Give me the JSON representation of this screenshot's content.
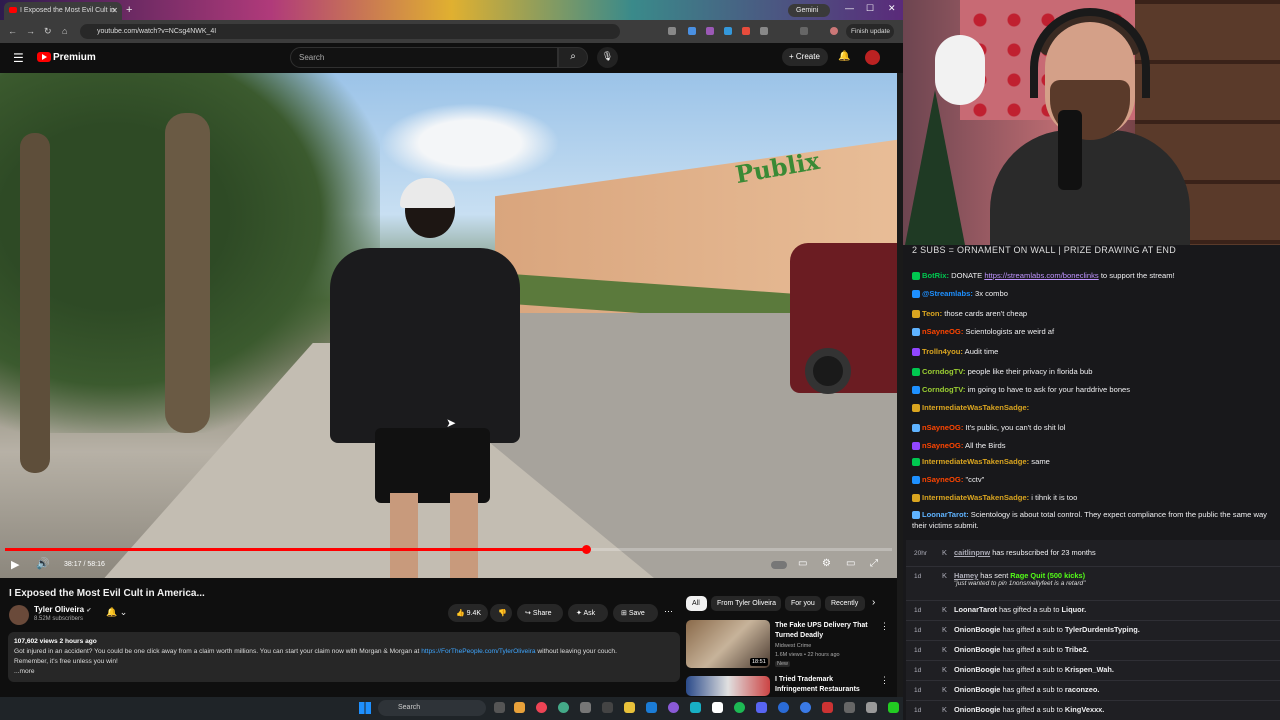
{
  "browser": {
    "tab_title": "I Exposed the Most Evil Cult in",
    "new_tab": "+",
    "gemini": "Gemini",
    "url": "youtube.com/watch?v=NCsg4NWK_4I",
    "finish_update": "Finish update",
    "win_min": "—",
    "win_max": "☐",
    "win_close": "✕"
  },
  "youtube": {
    "menu_icon": "☰",
    "brand": "Premium",
    "search_placeholder": "Search",
    "search_icon": "⌕",
    "mic_icon": "🎙",
    "create_label": "+ Create",
    "bell_icon": "🔔"
  },
  "player": {
    "progress_fraction": 0.655,
    "time": "38:17 / 58:16",
    "play_icon": "▶",
    "volume_icon": "🔊"
  },
  "video": {
    "title": "I Exposed the Most Evil Cult in America...",
    "channel": "Tyler Oliveira",
    "verified": "✔",
    "subscribers": "8.52M subscribers",
    "likes": "9.4K",
    "share": "Share",
    "ask": "Ask",
    "save": "Save",
    "views_time": "107,602 views  2 hours ago",
    "desc_line1_a": "Got injured in an accident? You could be one click away from a claim worth millions. You can start your claim now with Morgan & Morgan at ",
    "desc_link": "https://ForThePeople.com/TylerOliveira",
    "desc_line1_b": " without leaving your couch.",
    "desc_line2": "Remember, it's free unless you win!",
    "more": "...more"
  },
  "recs": {
    "chips": [
      "All",
      "From Tyler Oliveira",
      "For you",
      "Recently"
    ],
    "items": [
      {
        "title": "The Fake UPS Delivery That Turned Deadly",
        "channel": "Midwest Crime",
        "meta": "1.6M views • 22 hours ago",
        "badge": "New",
        "duration": "18:51"
      },
      {
        "title": "I Tried Trademark Infringement Restaurants",
        "channel": "",
        "meta": "",
        "badge": "",
        "duration": ""
      }
    ]
  },
  "taskbar": {
    "search": "Search"
  },
  "chat": {
    "banner": "2 SUBS = ORNAMENT ON WALL | PRIZE DRAWING AT END",
    "messages": [
      {
        "user": "BotRix:",
        "color": "#00c850",
        "text": " DONATE ",
        "link": "https://streamlabs.com/boneclinks",
        "after": " to support the stream!"
      },
      {
        "user": "@Streamlabs:",
        "color": "#1e90ff",
        "text": " 3x  combo",
        "link": "",
        "after": ""
      },
      {
        "user": "Teon:",
        "color": "#daa520",
        "text": "  those cards aren't cheap",
        "link": "",
        "after": ""
      },
      {
        "user": "nSayneOG:",
        "color": "#ff4500",
        "text": " Scientologists are weird af",
        "link": "",
        "after": ""
      },
      {
        "user": "Trolln4you:",
        "color": "#daa520",
        "text": " Audit time ",
        "link": "",
        "after": ""
      },
      {
        "user": "CorndogTV:",
        "color": "#9acd32",
        "text": " people like their privacy in florida bub",
        "link": "",
        "after": ""
      },
      {
        "user": "CorndogTV:",
        "color": "#9acd32",
        "text": " im going to have to ask for your harddrive bones",
        "link": "",
        "after": ""
      },
      {
        "user": "IntermediateWasTakenSadge:",
        "color": "#daa520",
        "text": " ",
        "link": "",
        "after": ""
      },
      {
        "user": "nSayneOG:",
        "color": "#ff4500",
        "text": " It's public, you can't do shit lol",
        "link": "",
        "after": ""
      },
      {
        "user": "nSayneOG:",
        "color": "#ff4500",
        "text": " All the Birds",
        "link": "",
        "after": ""
      },
      {
        "user": "IntermediateWasTakenSadge:",
        "color": "#daa520",
        "text": " same",
        "link": "",
        "after": ""
      },
      {
        "user": "nSayneOG:",
        "color": "#ff4500",
        "text": " \"cctv\"",
        "link": "",
        "after": ""
      },
      {
        "user": "IntermediateWasTakenSadge:",
        "color": "#daa520",
        "text": " i tihnk it is too",
        "link": "",
        "after": ""
      },
      {
        "user": "LoonarTarot:",
        "color": "#5fb3ff",
        "text": " Scientology is about total control. They expect compliance from the public the same way their victims submit.",
        "link": "",
        "after": ""
      }
    ],
    "events": [
      {
        "age": "20hr",
        "user": "caitlinpnw",
        "text": " has resubscribed for 23 months",
        "extra": ""
      },
      {
        "age": "1d",
        "user": "Hamey",
        "text": " has sent ",
        "extra": "Rage Quit (500 kicks)",
        "quote": "\"just wanted to pin 1nonsmellyfeet is a retard\""
      },
      {
        "age": "1d",
        "user": "LoonarTarot",
        "text": " has gifted a sub to ",
        "extra": "Liquor."
      },
      {
        "age": "1d",
        "user": "OnionBoogie",
        "text": " has gifted a sub to ",
        "extra": "TylerDurdenIsTyping."
      },
      {
        "age": "1d",
        "user": "OnionBoogie",
        "text": " has gifted a sub to ",
        "extra": "Tribe2."
      },
      {
        "age": "1d",
        "user": "OnionBoogie",
        "text": " has gifted a sub to ",
        "extra": "Krispen_Wah."
      },
      {
        "age": "1d",
        "user": "OnionBoogie",
        "text": " has gifted a sub to ",
        "extra": "raconzeo."
      },
      {
        "age": "1d",
        "user": "OnionBoogie",
        "text": " has gifted a sub to ",
        "extra": "KingVexxx."
      }
    ]
  }
}
